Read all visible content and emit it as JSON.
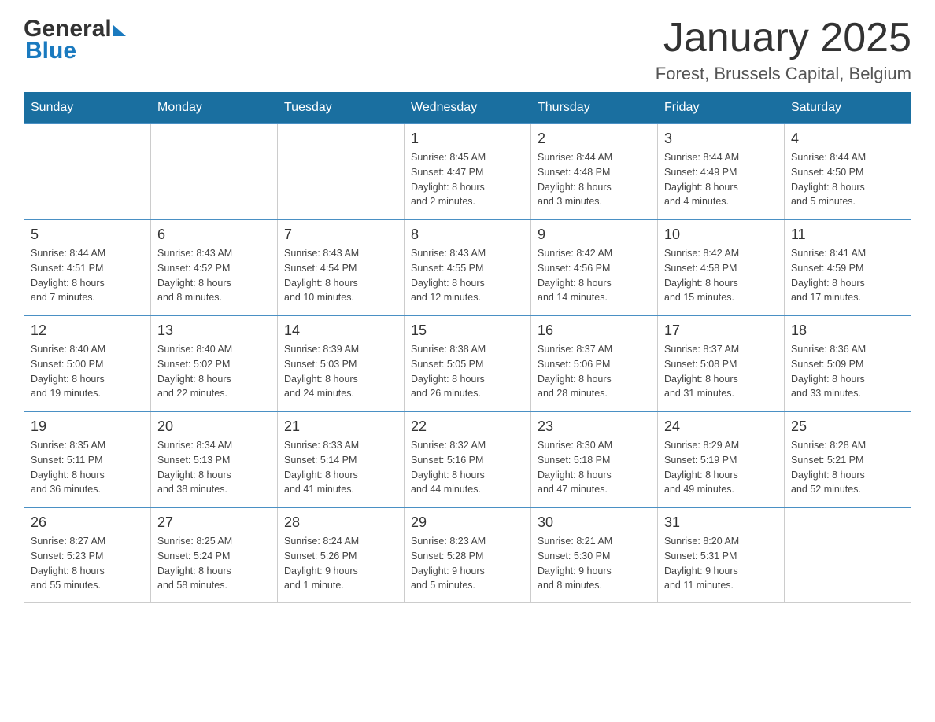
{
  "header": {
    "logo_general": "General",
    "logo_blue": "Blue",
    "title": "January 2025",
    "subtitle": "Forest, Brussels Capital, Belgium"
  },
  "calendar": {
    "days_of_week": [
      "Sunday",
      "Monday",
      "Tuesday",
      "Wednesday",
      "Thursday",
      "Friday",
      "Saturday"
    ],
    "weeks": [
      [
        {
          "day": "",
          "info": ""
        },
        {
          "day": "",
          "info": ""
        },
        {
          "day": "",
          "info": ""
        },
        {
          "day": "1",
          "info": "Sunrise: 8:45 AM\nSunset: 4:47 PM\nDaylight: 8 hours\nand 2 minutes."
        },
        {
          "day": "2",
          "info": "Sunrise: 8:44 AM\nSunset: 4:48 PM\nDaylight: 8 hours\nand 3 minutes."
        },
        {
          "day": "3",
          "info": "Sunrise: 8:44 AM\nSunset: 4:49 PM\nDaylight: 8 hours\nand 4 minutes."
        },
        {
          "day": "4",
          "info": "Sunrise: 8:44 AM\nSunset: 4:50 PM\nDaylight: 8 hours\nand 5 minutes."
        }
      ],
      [
        {
          "day": "5",
          "info": "Sunrise: 8:44 AM\nSunset: 4:51 PM\nDaylight: 8 hours\nand 7 minutes."
        },
        {
          "day": "6",
          "info": "Sunrise: 8:43 AM\nSunset: 4:52 PM\nDaylight: 8 hours\nand 8 minutes."
        },
        {
          "day": "7",
          "info": "Sunrise: 8:43 AM\nSunset: 4:54 PM\nDaylight: 8 hours\nand 10 minutes."
        },
        {
          "day": "8",
          "info": "Sunrise: 8:43 AM\nSunset: 4:55 PM\nDaylight: 8 hours\nand 12 minutes."
        },
        {
          "day": "9",
          "info": "Sunrise: 8:42 AM\nSunset: 4:56 PM\nDaylight: 8 hours\nand 14 minutes."
        },
        {
          "day": "10",
          "info": "Sunrise: 8:42 AM\nSunset: 4:58 PM\nDaylight: 8 hours\nand 15 minutes."
        },
        {
          "day": "11",
          "info": "Sunrise: 8:41 AM\nSunset: 4:59 PM\nDaylight: 8 hours\nand 17 minutes."
        }
      ],
      [
        {
          "day": "12",
          "info": "Sunrise: 8:40 AM\nSunset: 5:00 PM\nDaylight: 8 hours\nand 19 minutes."
        },
        {
          "day": "13",
          "info": "Sunrise: 8:40 AM\nSunset: 5:02 PM\nDaylight: 8 hours\nand 22 minutes."
        },
        {
          "day": "14",
          "info": "Sunrise: 8:39 AM\nSunset: 5:03 PM\nDaylight: 8 hours\nand 24 minutes."
        },
        {
          "day": "15",
          "info": "Sunrise: 8:38 AM\nSunset: 5:05 PM\nDaylight: 8 hours\nand 26 minutes."
        },
        {
          "day": "16",
          "info": "Sunrise: 8:37 AM\nSunset: 5:06 PM\nDaylight: 8 hours\nand 28 minutes."
        },
        {
          "day": "17",
          "info": "Sunrise: 8:37 AM\nSunset: 5:08 PM\nDaylight: 8 hours\nand 31 minutes."
        },
        {
          "day": "18",
          "info": "Sunrise: 8:36 AM\nSunset: 5:09 PM\nDaylight: 8 hours\nand 33 minutes."
        }
      ],
      [
        {
          "day": "19",
          "info": "Sunrise: 8:35 AM\nSunset: 5:11 PM\nDaylight: 8 hours\nand 36 minutes."
        },
        {
          "day": "20",
          "info": "Sunrise: 8:34 AM\nSunset: 5:13 PM\nDaylight: 8 hours\nand 38 minutes."
        },
        {
          "day": "21",
          "info": "Sunrise: 8:33 AM\nSunset: 5:14 PM\nDaylight: 8 hours\nand 41 minutes."
        },
        {
          "day": "22",
          "info": "Sunrise: 8:32 AM\nSunset: 5:16 PM\nDaylight: 8 hours\nand 44 minutes."
        },
        {
          "day": "23",
          "info": "Sunrise: 8:30 AM\nSunset: 5:18 PM\nDaylight: 8 hours\nand 47 minutes."
        },
        {
          "day": "24",
          "info": "Sunrise: 8:29 AM\nSunset: 5:19 PM\nDaylight: 8 hours\nand 49 minutes."
        },
        {
          "day": "25",
          "info": "Sunrise: 8:28 AM\nSunset: 5:21 PM\nDaylight: 8 hours\nand 52 minutes."
        }
      ],
      [
        {
          "day": "26",
          "info": "Sunrise: 8:27 AM\nSunset: 5:23 PM\nDaylight: 8 hours\nand 55 minutes."
        },
        {
          "day": "27",
          "info": "Sunrise: 8:25 AM\nSunset: 5:24 PM\nDaylight: 8 hours\nand 58 minutes."
        },
        {
          "day": "28",
          "info": "Sunrise: 8:24 AM\nSunset: 5:26 PM\nDaylight: 9 hours\nand 1 minute."
        },
        {
          "day": "29",
          "info": "Sunrise: 8:23 AM\nSunset: 5:28 PM\nDaylight: 9 hours\nand 5 minutes."
        },
        {
          "day": "30",
          "info": "Sunrise: 8:21 AM\nSunset: 5:30 PM\nDaylight: 9 hours\nand 8 minutes."
        },
        {
          "day": "31",
          "info": "Sunrise: 8:20 AM\nSunset: 5:31 PM\nDaylight: 9 hours\nand 11 minutes."
        },
        {
          "day": "",
          "info": ""
        }
      ]
    ]
  }
}
